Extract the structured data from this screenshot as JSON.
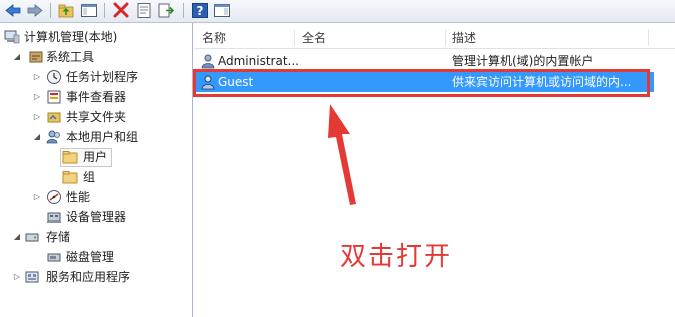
{
  "toolbar": {
    "buttons": [
      "back-icon",
      "forward-icon",
      "up-folder-icon",
      "show-hide-tree-icon",
      "delete-icon",
      "properties-icon",
      "export-icon",
      "help-icon",
      "show-action-pane-icon"
    ]
  },
  "tree": {
    "root": "计算机管理(本地)",
    "system_tools": "系统工具",
    "task_scheduler": "任务计划程序",
    "event_viewer": "事件查看器",
    "shared_folders": "共享文件夹",
    "local_users_groups": "本地用户和组",
    "users": "用户",
    "groups": "组",
    "performance": "性能",
    "device_manager": "设备管理器",
    "storage": "存储",
    "disk_management": "磁盘管理",
    "services_apps": "服务和应用程序"
  },
  "list": {
    "columns": [
      "名称",
      "全名",
      "描述"
    ],
    "rows": [
      {
        "name": "Administrat...",
        "fullname": "",
        "description": "管理计算机(域)的内置帐户"
      },
      {
        "name": "Guest",
        "fullname": "",
        "description": "供来宾访问计算机或访问域的内..."
      }
    ]
  },
  "annotation": "双击打开",
  "colors": {
    "accent_selected": "#3399ff",
    "annotation_red": "#e53935"
  }
}
